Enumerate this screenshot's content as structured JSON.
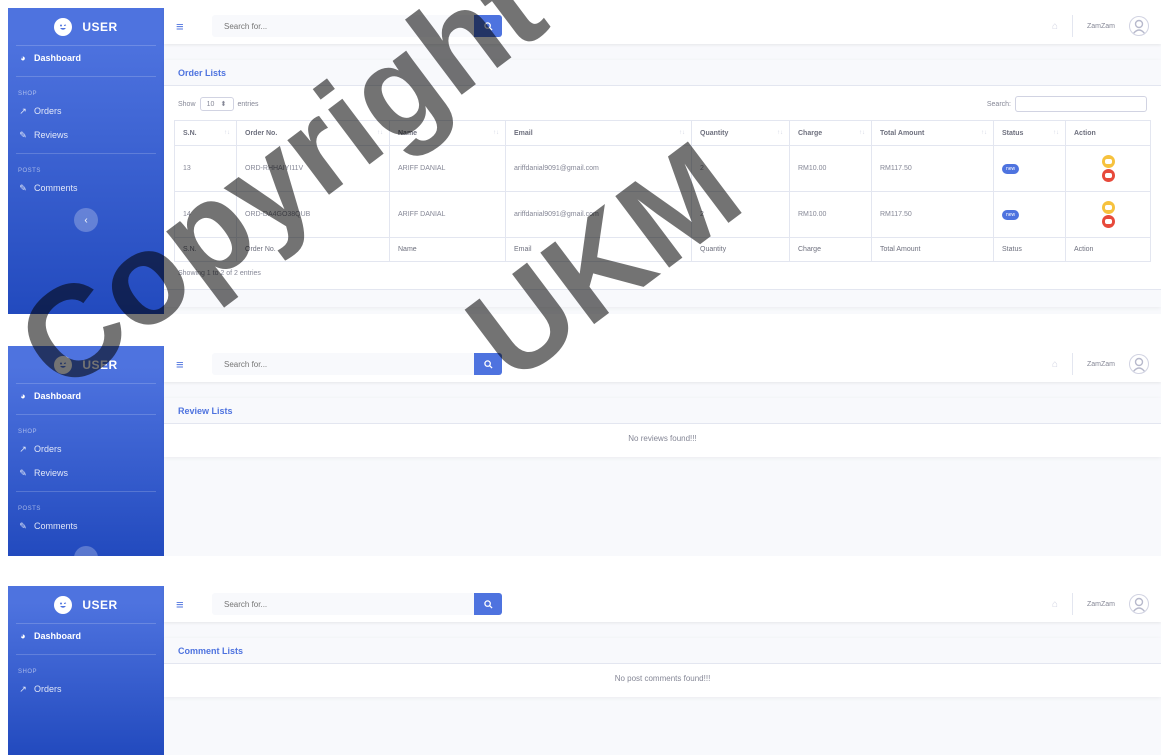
{
  "sidebar": {
    "brand": "USER",
    "dashboard": "Dashboard",
    "heading_shop": "SHOP",
    "orders": "Orders",
    "reviews": "Reviews",
    "heading_posts": "POSTS",
    "comments": "Comments",
    "toggle_glyph": "‹"
  },
  "topbar": {
    "search_placeholder": "Search for...",
    "username": "ZamZam"
  },
  "orders_page": {
    "card_title": "Order Lists",
    "show_label": "Show",
    "entries_value": "10",
    "entries_label": "entries",
    "search_label": "Search:",
    "columns": [
      "S.N.",
      "Order No.",
      "Name",
      "Email",
      "Quantity",
      "Charge",
      "Total Amount",
      "Status",
      "Action"
    ],
    "rows": [
      {
        "sn": "13",
        "order_no": "ORD-RHHAIYI11V",
        "name": "ARIFF DANIAL",
        "email": "ariffdanial9091@gmail.com",
        "quantity": "2",
        "charge": "RM10.00",
        "total": "RM117.50",
        "status": "new"
      },
      {
        "sn": "14",
        "order_no": "ORD-DA4GO38QUB",
        "name": "ARIFF DANIAL",
        "email": "ariffdanial9091@gmail.com",
        "quantity": "2",
        "charge": "RM10.00",
        "total": "RM117.50",
        "status": "new"
      }
    ],
    "info": "Showing 1 to 2 of 2 entries"
  },
  "reviews_page": {
    "card_title": "Review Lists",
    "empty": "No reviews found!!!"
  },
  "comments_page": {
    "card_title": "Comment Lists",
    "empty": "No post comments found!!!"
  },
  "watermark": {
    "line1": "Copyright",
    "line2": "UKM"
  },
  "colors": {
    "primary": "#4e73df",
    "warning": "#f6c23e",
    "danger": "#e74a3b"
  }
}
